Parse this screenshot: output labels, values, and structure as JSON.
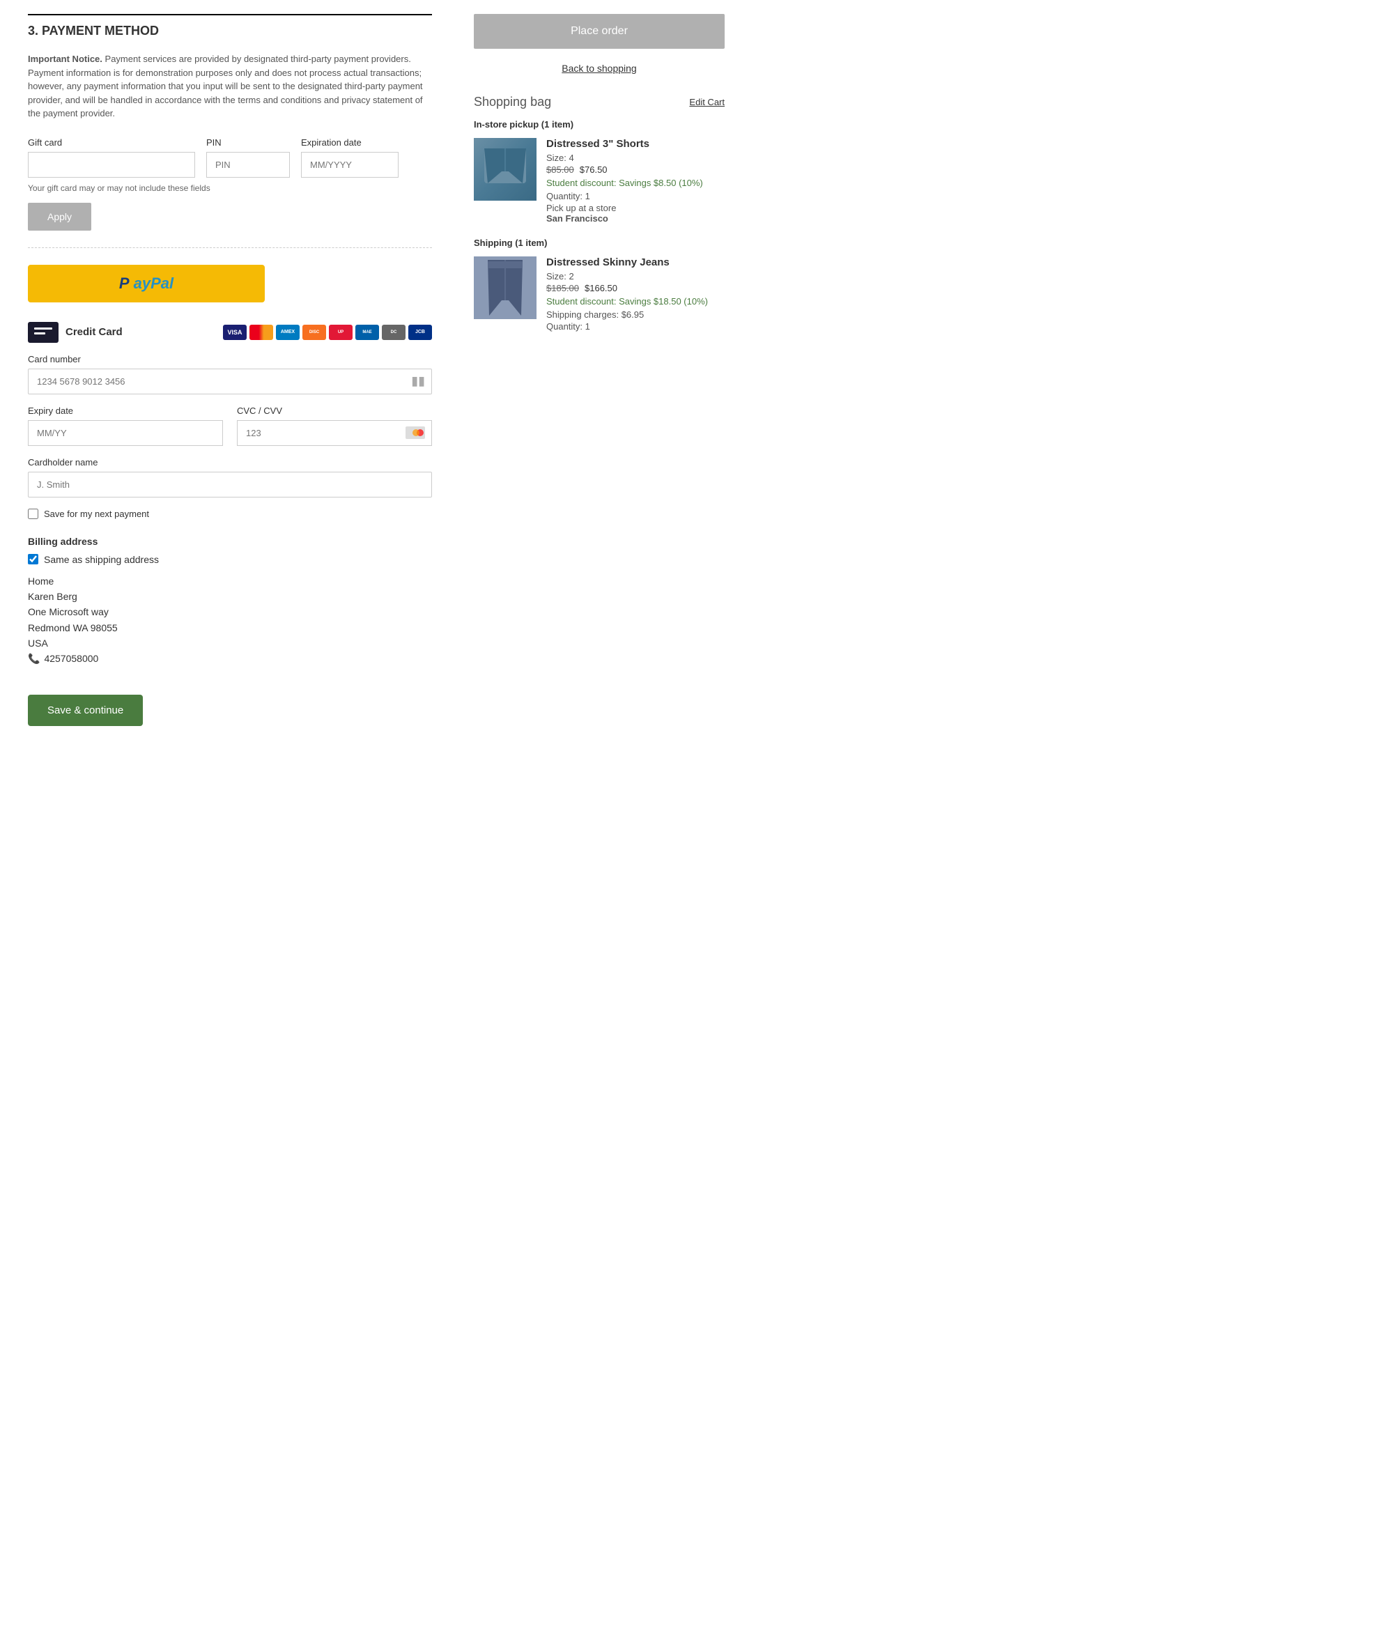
{
  "page": {
    "section_title": "3. PAYMENT METHOD",
    "notice": {
      "bold_text": "Important Notice.",
      "text": "  Payment services are provided by designated third-party payment providers.  Payment information is for demonstration purposes only and does not process actual transactions; however, any payment information that you input will be sent to the designated third-party payment provider, and will be handled in accordance with the terms and conditions and privacy statement of the payment provider."
    },
    "gift_card": {
      "label": "Gift card",
      "pin_label": "PIN",
      "pin_placeholder": "PIN",
      "expiration_label": "Expiration date",
      "expiration_placeholder": "MM/YYYY",
      "hint": "Your gift card may or may not include these fields",
      "apply_button": "Apply"
    },
    "paypal": {
      "p_text": "P",
      "pal_text": "PayPal"
    },
    "credit_card": {
      "label": "Credit Card",
      "card_number_label": "Card number",
      "card_number_placeholder": "1234 5678 9012 3456",
      "expiry_label": "Expiry date",
      "expiry_placeholder": "MM/YY",
      "cvc_label": "CVC / CVV",
      "cvc_placeholder": "123",
      "cardholder_label": "Cardholder name",
      "cardholder_placeholder": "J. Smith",
      "save_label": "Save for my next payment"
    },
    "billing": {
      "title": "Billing address",
      "same_as_shipping_label": "Same as shipping address",
      "address_type": "Home",
      "name": "Karen Berg",
      "street": "One Microsoft way",
      "city_state_zip": "Redmond WA  98055",
      "country": "USA",
      "phone": "4257058000"
    },
    "save_continue_button": "Save & continue"
  },
  "right_panel": {
    "place_order_button": "Place order",
    "back_to_shopping": "Back to shopping",
    "shopping_bag_title": "Shopping bag",
    "edit_cart_link": "Edit Cart",
    "pickup_label": "In-store pickup (1 item)",
    "shipping_label": "Shipping (1 item)",
    "item1": {
      "name": "Distressed 3\" Shorts",
      "size_label": "Size:",
      "size": "4",
      "price_original": "$85.00",
      "price_sale": "$76.50",
      "discount": "Student discount: Savings $8.50 (10%)",
      "quantity_label": "Quantity:",
      "quantity": "1",
      "pickup_label": "Pick up at a store",
      "pickup_store": "San Francisco"
    },
    "item2": {
      "name": "Distressed Skinny Jeans",
      "size_label": "Size:",
      "size": "2",
      "price_original": "$185.00",
      "price_sale": "$166.50",
      "discount": "Student discount: Savings $18.50 (10%)",
      "shipping_charges_label": "Shipping charges:",
      "shipping_charges": "$6.95",
      "quantity_label": "Quantity:",
      "quantity": "1"
    }
  },
  "card_logos": [
    {
      "name": "visa",
      "class": "logo-visa",
      "text": "VISA"
    },
    {
      "name": "mastercard",
      "class": "logo-mc",
      "text": "MC"
    },
    {
      "name": "amex",
      "class": "logo-amex",
      "text": "AMEX"
    },
    {
      "name": "discover",
      "class": "logo-disc",
      "text": "DISC"
    },
    {
      "name": "unionpay",
      "class": "logo-unionpay",
      "text": "UP"
    },
    {
      "name": "maestro",
      "class": "logo-maestro",
      "text": "MAE"
    },
    {
      "name": "dinersclub",
      "class": "logo-dinersclub",
      "text": "DC"
    },
    {
      "name": "jcb",
      "class": "logo-jcb",
      "text": "JCB"
    }
  ]
}
